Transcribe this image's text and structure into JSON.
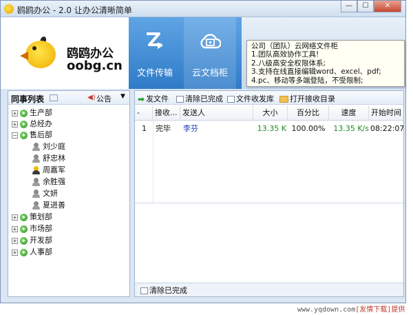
{
  "window": {
    "title": "鸥鸥办公 - 2.0 让办公清晰简单",
    "minimize": "—",
    "maximize": "☐",
    "close": "✕"
  },
  "brand": {
    "name": "鸥鸥办公",
    "domain": "oobg.cn"
  },
  "nav": {
    "tabs": [
      {
        "label": "文件传输",
        "icon": "file-transfer-icon"
      },
      {
        "label": "云文档柜",
        "icon": "cloud-cabinet-icon",
        "active": true
      }
    ]
  },
  "tooltip": {
    "lines": [
      "公司（团队）云网络文件柜",
      "1.团队高效协作工具!",
      "2.八级高安全权限体系;",
      "3.支持在线直接编辑word、excel、pdf;",
      "4.pc、移动等多端登陆，不受限制;"
    ]
  },
  "contacts": {
    "title": "同事列表",
    "notice": "公告",
    "groups": [
      {
        "name": "生产部",
        "expanded": false
      },
      {
        "name": "总经办",
        "expanded": false
      },
      {
        "name": "售后部",
        "expanded": true,
        "members": [
          {
            "name": "刘少庭",
            "online": false
          },
          {
            "name": "舒忠林",
            "online": false
          },
          {
            "name": "周嘉军",
            "online": true
          },
          {
            "name": "余胜强",
            "online": false
          },
          {
            "name": "文妍",
            "online": false
          },
          {
            "name": "夏进善",
            "online": false
          }
        ]
      },
      {
        "name": "策划部",
        "expanded": false
      },
      {
        "name": "市场部",
        "expanded": false
      },
      {
        "name": "开发部",
        "expanded": false
      },
      {
        "name": "人事部",
        "expanded": false
      }
    ]
  },
  "toolbar": {
    "send_file": "发文件",
    "clear_done": "清除已完成",
    "inbox": "文件收发库",
    "open_dir": "打开接收目录"
  },
  "transfers": {
    "columns": [
      "-",
      "接收...",
      "发送人",
      "大小",
      "百分比",
      "速度",
      "开始时间"
    ],
    "rows": [
      {
        "index": "1",
        "status": "完毕",
        "sender": "李芬",
        "size": "13.35 K",
        "percent": "100.00%",
        "speed": "13.35 K/s",
        "start": "08:22:07"
      }
    ]
  },
  "bottom": {
    "clear_done": "清除已完成"
  },
  "watermark": {
    "site": "www.yqdown.com",
    "provider": "[友情下载]提供"
  },
  "colors": {
    "nav_blue": "#2f7bc8",
    "success_green": "#1d8a1d",
    "sender_blue": "#1a3fb0"
  }
}
